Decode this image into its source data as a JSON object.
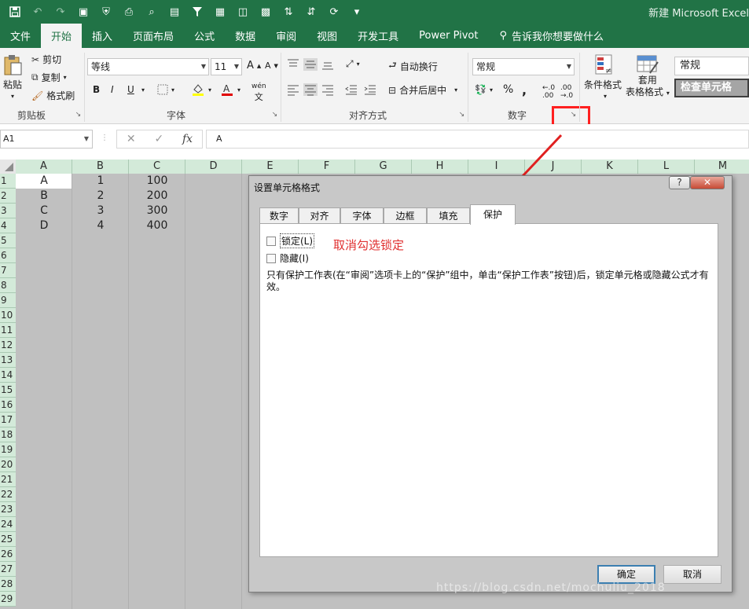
{
  "window": {
    "title": "新建 Microsoft Excel"
  },
  "ribbon_tabs": [
    "文件",
    "开始",
    "插入",
    "页面布局",
    "公式",
    "数据",
    "审阅",
    "视图",
    "开发工具",
    "Power Pivot"
  ],
  "tell_me": "告诉我你想要做什么",
  "clipboard": {
    "paste": "粘贴",
    "cut": "剪切",
    "copy": "复制",
    "format_painter": "格式刷",
    "group": "剪贴板"
  },
  "font": {
    "name": "等线",
    "size": "11",
    "bold": "B",
    "italic": "I",
    "underline": "U",
    "group": "字体"
  },
  "alignment": {
    "wrap": "自动换行",
    "merge": "合并后居中",
    "group": "对齐方式"
  },
  "number": {
    "format": "常规",
    "group": "数字",
    "percent": "%",
    "comma": ","
  },
  "styles": {
    "conditional_1": "条件格式",
    "table_1": "套用",
    "table_2": "表格格式",
    "normal": "常规",
    "check_cell": "检查单元格"
  },
  "formula_bar": {
    "name_box": "A1",
    "content": "A",
    "fx": "fx"
  },
  "columns": [
    "A",
    "B",
    "C",
    "D",
    "E",
    "F",
    "G",
    "H",
    "I",
    "J",
    "K",
    "L",
    "M"
  ],
  "rows": [
    "1",
    "2",
    "3",
    "4",
    "5",
    "6",
    "7",
    "8",
    "9",
    "10",
    "11",
    "12",
    "13",
    "14",
    "15",
    "16",
    "17",
    "18",
    "19",
    "20",
    "21",
    "22",
    "23",
    "24",
    "25",
    "26",
    "27",
    "28",
    "29"
  ],
  "cells": [
    [
      "A",
      "1",
      "100"
    ],
    [
      "B",
      "2",
      "200"
    ],
    [
      "C",
      "3",
      "300"
    ],
    [
      "D",
      "4",
      "400"
    ]
  ],
  "dialog": {
    "title": "设置单元格格式",
    "help": "?",
    "close": "✕",
    "tabs": [
      "数字",
      "对齐",
      "字体",
      "边框",
      "填充",
      "保护"
    ],
    "locked_label": "锁定(L)",
    "hidden_label": "隐藏(I)",
    "note": "只有保护工作表(在“审阅”选项卡上的“保护”组中，单击“保护工作表”按钮)后，锁定单元格或隐藏公式才有效。",
    "annotation": "取消勾选锁定",
    "ok": "确定",
    "cancel": "取消"
  },
  "watermark": "https://blog.csdn.net/mochuliu_2018",
  "colors": {
    "excel_green": "#217346",
    "highlight": "#ff2020"
  }
}
